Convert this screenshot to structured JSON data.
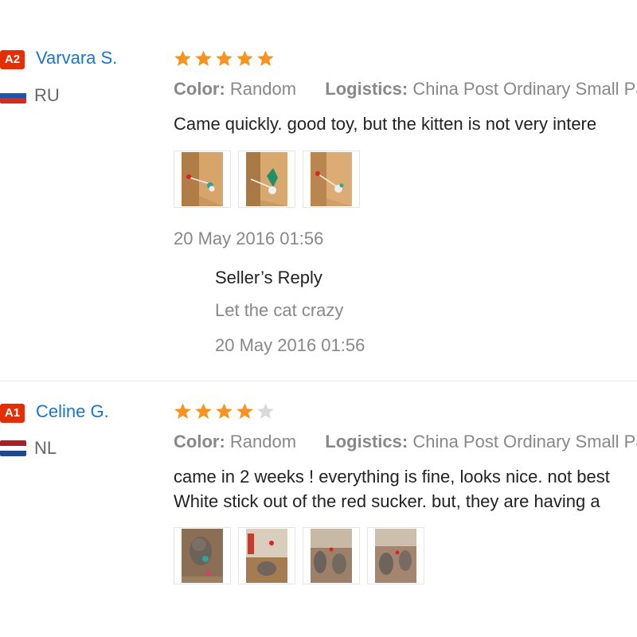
{
  "reviews": [
    {
      "level_badge": "A2",
      "name": "Varvara S.",
      "country": "RU",
      "rating": 5,
      "color_label": "Color:",
      "color_value": "Random",
      "logistics_label": "Logistics:",
      "logistics_value": "China Post Ordinary Small Pa",
      "comment_lines": [
        "Came quickly. good toy, but the kitten is not very intere"
      ],
      "photo_count": 3,
      "date": "20 May 2016 01:56",
      "reply": {
        "title": "Seller’s Reply",
        "text": "Let the cat crazy",
        "date": "20 May 2016 01:56"
      }
    },
    {
      "level_badge": "A1",
      "name": "Celine G.",
      "country": "NL",
      "rating": 4,
      "color_label": "Color:",
      "color_value": "Random",
      "logistics_label": "Logistics:",
      "logistics_value": "China Post Ordinary Small Pa",
      "comment_lines": [
        "came in 2 weeks ! everything is fine, looks nice. not best",
        "White stick out of the red sucker. but, they are having a"
      ],
      "photo_count": 4
    }
  ],
  "colors": {
    "badge": "#e62e04",
    "name": "#1a75cf",
    "star_filled": "#f7931e",
    "star_empty": "#d9d9d9",
    "muted_text": "#888888"
  },
  "flags": {
    "RU": [
      "#ffffff",
      "#1c57a7",
      "#d52b1e"
    ],
    "NL": [
      "#ae1c28",
      "#ffffff",
      "#21468b"
    ]
  }
}
